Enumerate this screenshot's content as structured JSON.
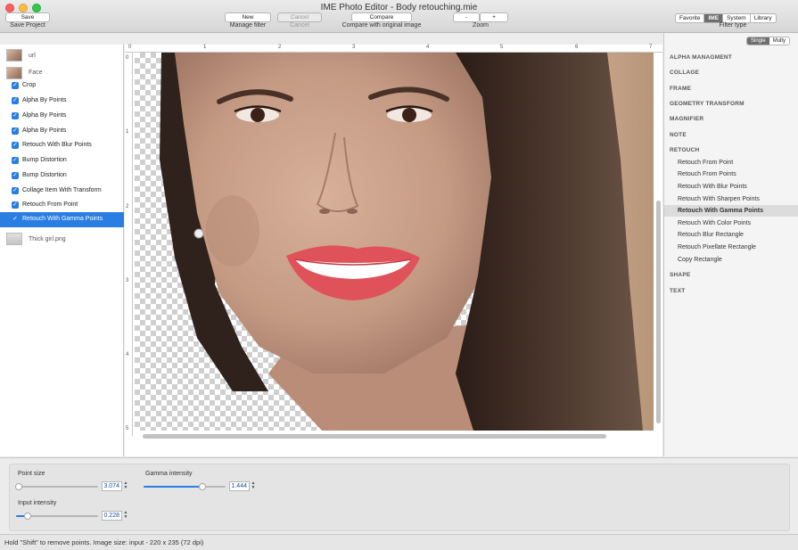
{
  "window": {
    "title": "IME Photo Editor - Body retouching.mie"
  },
  "toolbar": {
    "save_button": "Save",
    "save_label": "Save Project",
    "new_button": "New",
    "new_label": "Manage filter",
    "cancel_button": "Cancel",
    "cancel_label": "Cancel",
    "compare_button": "Compare",
    "compare_label": "Compare with original image",
    "zoom_out": "-",
    "zoom_in": "+",
    "zoom_label": "Zoom",
    "filter_type_label": "Filter type",
    "filter_types": [
      "Favorite",
      "IME",
      "System",
      "Library"
    ],
    "filter_type_selected": "IME"
  },
  "layers": {
    "group1": "url",
    "group2": "Face",
    "items": [
      {
        "label": "Crop",
        "checked": true
      },
      {
        "label": "Alpha By Points",
        "checked": true
      },
      {
        "label": "Alpha By Points",
        "checked": true
      },
      {
        "label": "Alpha By Points",
        "checked": true
      },
      {
        "label": "Retouch With Blur Points",
        "checked": true
      },
      {
        "label": "Bump Distortion",
        "checked": true
      },
      {
        "label": "Bump Distortion",
        "checked": true
      },
      {
        "label": "Collage Item With Transform",
        "checked": true
      },
      {
        "label": "Retouch From Point",
        "checked": true
      },
      {
        "label": "Retouch With Gamma Points",
        "checked": true,
        "selected": true
      }
    ],
    "group3": "Thick girl.png"
  },
  "ruler": {
    "h": [
      "0",
      "1",
      "2",
      "3",
      "4",
      "5",
      "6",
      "7"
    ],
    "v": [
      "0",
      "1",
      "2",
      "3",
      "4",
      "5"
    ]
  },
  "filters": {
    "mode": [
      "Single",
      "Multy"
    ],
    "mode_selected": "Single",
    "categories": {
      "alpha": "ALPHA MANAGMENT",
      "collage": "COLLAGE",
      "frame": "FRAME",
      "geometry": "GEOMETRY TRANSFORM",
      "magnifier": "MAGNIFIER",
      "note": "NOTE",
      "retouch": "RETOUCH",
      "shape": "SHAPE",
      "text": "TEXT"
    },
    "retouch_items": [
      "Retouch From Point",
      "Retouch From Points",
      "Retouch With Blur Points",
      "Retouch With Sharpen Points",
      "Retouch With Gamma Points",
      "Retouch With Color Points",
      "Retouch Blur Rectangle",
      "Retouch Pixellate Rectangle",
      "Copy Rectangle"
    ],
    "selected": "Retouch With Gamma Points"
  },
  "properties": {
    "point_size_label": "Point size",
    "point_size_value": "3.074",
    "point_size_level": 0.03,
    "gamma_label": "Gamma intensity",
    "gamma_value": "1.444",
    "gamma_level": 0.72,
    "input_label": "Input intensity",
    "input_value": "0.228",
    "input_level": 0.14
  },
  "status": {
    "text": "Hold \"Shift\" to remove points.  Image size: input - 220 x 235 (72 dpi)"
  },
  "colors": {
    "accent": "#2a7de1",
    "hair": "#3b2a22",
    "skin": "#c9a08a",
    "lips": "#e0525a"
  }
}
